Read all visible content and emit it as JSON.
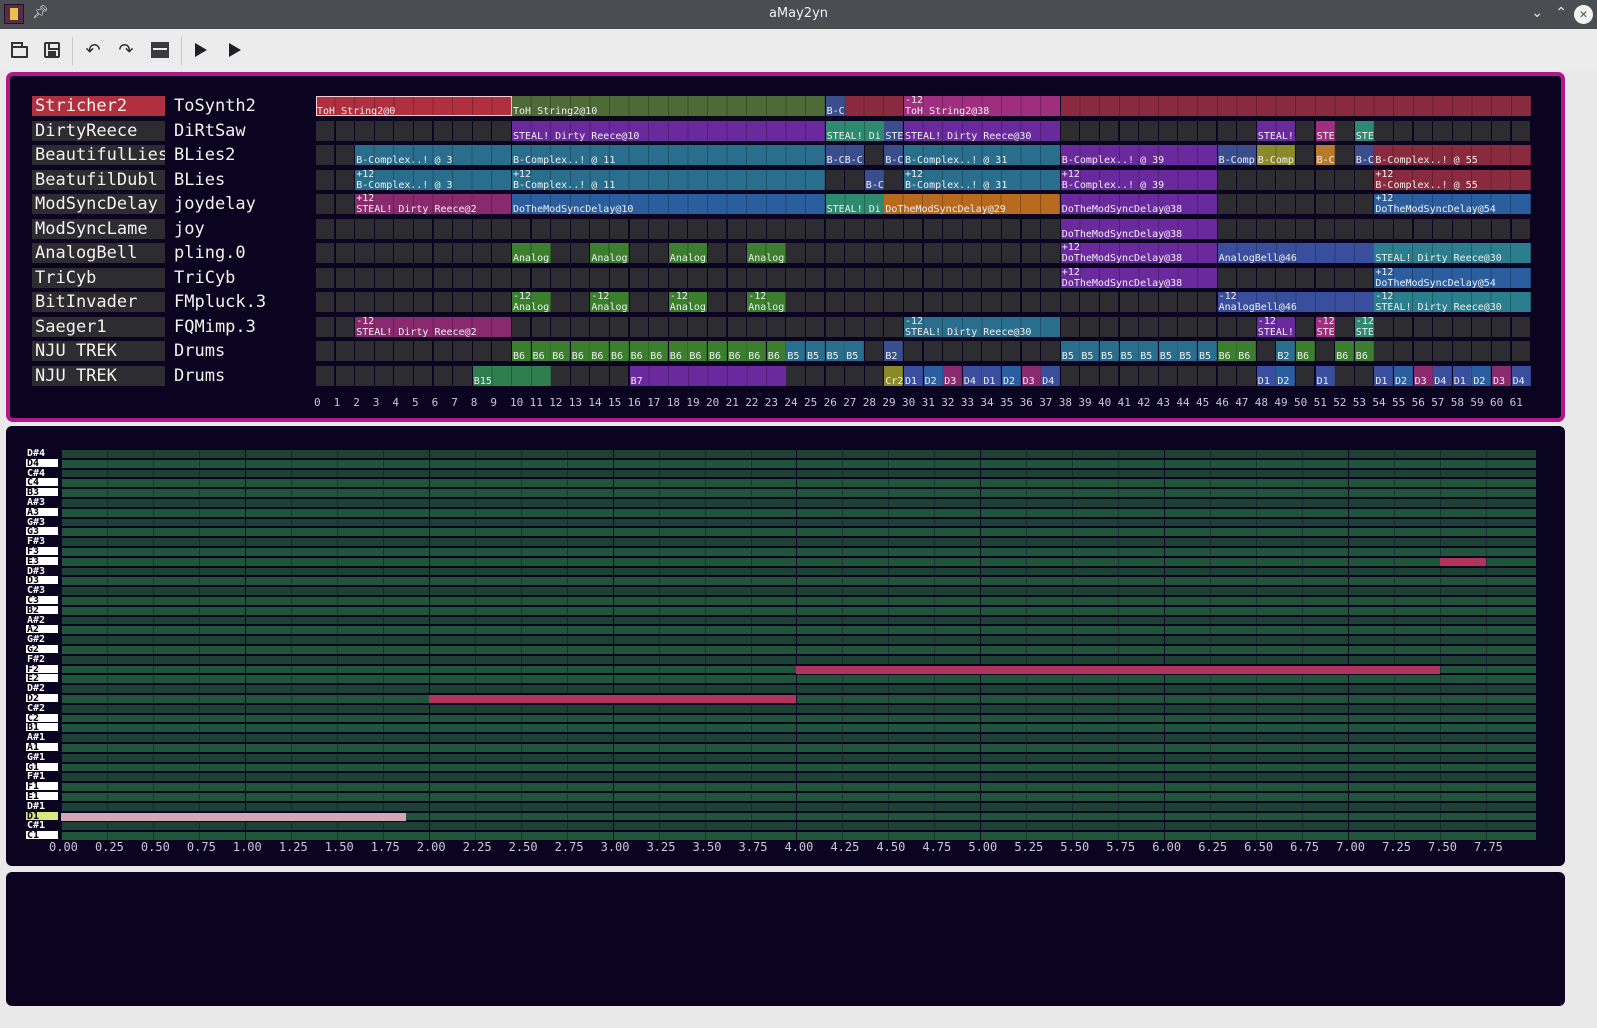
{
  "window": {
    "title": "aMay2yn"
  },
  "titlebar_icons": [
    "app-icon",
    "pin-icon",
    "minimize-icon",
    "maximize-icon",
    "close-icon"
  ],
  "toolbar": {
    "buttons": [
      "open-icon",
      "save-icon",
      "undo-icon",
      "redo-icon",
      "window-icon",
      "play-icon",
      "play-next-icon"
    ]
  },
  "colors": {
    "accent": "#b2178a",
    "panel_bg": "#0b0420",
    "selected_track": "#b03040",
    "note_piano": "#b0355c",
    "note_drum": "#d4a6b6"
  },
  "tracks": [
    {
      "name": "Stricher2",
      "instrument": "ToSynth2",
      "selected": true
    },
    {
      "name": "DirtyReece",
      "instrument": "DiRtSaw"
    },
    {
      "name": "BeautifulLies",
      "instrument": "BLies2"
    },
    {
      "name": "BeatufilDubl",
      "instrument": "BLies"
    },
    {
      "name": "ModSyncDelay",
      "instrument": "joydelay"
    },
    {
      "name": "ModSyncLame",
      "instrument": "joy"
    },
    {
      "name": "AnalogBell",
      "instrument": "pling.0"
    },
    {
      "name": "TriCyb",
      "instrument": "TriCyb"
    },
    {
      "name": "BitInvader",
      "instrument": "FMpluck.3"
    },
    {
      "name": "Saeger1",
      "instrument": "FQMimp.3"
    },
    {
      "name": "NJU TREK",
      "instrument": "Drums"
    },
    {
      "name": "NJU TREK",
      "instrument": "Drums"
    }
  ],
  "sequencer": {
    "beat_count": 62,
    "clips": [
      {
        "track": 0,
        "start": 0,
        "len": 10,
        "color": "#b03040",
        "label": "ToH_String2@0",
        "top": "",
        "outline": true
      },
      {
        "track": 0,
        "start": 10,
        "len": 16,
        "color": "#4e6a36",
        "label": "ToH_String2@10",
        "top": ""
      },
      {
        "track": 0,
        "start": 26,
        "len": 1,
        "color": "#3a4e8e",
        "label": "B-C",
        "top": ""
      },
      {
        "track": 0,
        "start": 27,
        "len": 3,
        "color": "#8a2a3e",
        "label": "",
        "top": ""
      },
      {
        "track": 0,
        "start": 30,
        "len": 8,
        "color": "#a02e7e",
        "label": "ToH_String2@38",
        "top": "-12"
      },
      {
        "track": 0,
        "start": 38,
        "len": 24,
        "color": "#8a2a3e",
        "label": "",
        "top": ""
      },
      {
        "track": 1,
        "start": 10,
        "len": 16,
        "color": "#6a2a9e",
        "label": "STEAL! Dirty Reece@10",
        "top": ""
      },
      {
        "track": 1,
        "start": 26,
        "len": 3,
        "color": "#2e8a6e",
        "label": "STEAL! Di",
        "top": ""
      },
      {
        "track": 1,
        "start": 29,
        "len": 1,
        "color": "#3a4e8e",
        "label": "STE",
        "top": ""
      },
      {
        "track": 1,
        "start": 30,
        "len": 8,
        "color": "#6a2a9e",
        "label": "STEAL! Dirty Reece@30",
        "top": ""
      },
      {
        "track": 1,
        "start": 48,
        "len": 2,
        "color": "#6a2a9e",
        "label": "STEAL!",
        "top": ""
      },
      {
        "track": 1,
        "start": 51,
        "len": 1,
        "color": "#a02e7e",
        "label": "STE",
        "top": ""
      },
      {
        "track": 1,
        "start": 53,
        "len": 1,
        "color": "#2e8a6e",
        "label": "STE",
        "top": ""
      },
      {
        "track": 2,
        "start": 2,
        "len": 8,
        "color": "#2a6e8e",
        "label": "B-Complex..! @ 3",
        "top": ""
      },
      {
        "track": 2,
        "start": 10,
        "len": 16,
        "color": "#2a6e8e",
        "label": "B-Complex..! @ 11",
        "top": ""
      },
      {
        "track": 2,
        "start": 26,
        "len": 2,
        "color": "#3a4e8e",
        "label": "B-CB-C",
        "top": ""
      },
      {
        "track": 2,
        "start": 29,
        "len": 1,
        "color": "#3a4e8e",
        "label": "B-C",
        "top": ""
      },
      {
        "track": 2,
        "start": 30,
        "len": 8,
        "color": "#2a6e8e",
        "label": "B-Complex..! @ 31",
        "top": ""
      },
      {
        "track": 2,
        "start": 38,
        "len": 8,
        "color": "#6a2a9e",
        "label": "B-Complex..! @ 39",
        "top": ""
      },
      {
        "track": 2,
        "start": 46,
        "len": 2,
        "color": "#3a4e8e",
        "label": "B-Comp",
        "top": ""
      },
      {
        "track": 2,
        "start": 48,
        "len": 2,
        "color": "#8a8a2a",
        "label": "B-Comp",
        "top": ""
      },
      {
        "track": 2,
        "start": 51,
        "len": 1,
        "color": "#b87a2a",
        "label": "B-C",
        "top": ""
      },
      {
        "track": 2,
        "start": 53,
        "len": 1,
        "color": "#3a4e8e",
        "label": "B-C",
        "top": ""
      },
      {
        "track": 2,
        "start": 54,
        "len": 8,
        "color": "#8a2a3e",
        "label": "B-Complex..! @ 55",
        "top": ""
      },
      {
        "track": 3,
        "start": 2,
        "len": 8,
        "color": "#2a6e8e",
        "label": "B-Complex..! @ 3",
        "top": "+12"
      },
      {
        "track": 3,
        "start": 10,
        "len": 16,
        "color": "#2a6e8e",
        "label": "B-Complex..! @ 11",
        "top": "+12"
      },
      {
        "track": 3,
        "start": 28,
        "len": 1,
        "color": "#3a4e8e",
        "label": "B-C",
        "top": ""
      },
      {
        "track": 3,
        "start": 30,
        "len": 8,
        "color": "#2a6e8e",
        "label": "B-Complex..! @ 31",
        "top": "+12"
      },
      {
        "track": 3,
        "start": 38,
        "len": 8,
        "color": "#6a2a9e",
        "label": "B-Complex..! @ 39",
        "top": "+12"
      },
      {
        "track": 3,
        "start": 54,
        "len": 8,
        "color": "#8a2a3e",
        "label": "B-Complex..! @ 55",
        "top": "+12"
      },
      {
        "track": 4,
        "start": 2,
        "len": 8,
        "color": "#8a2a6e",
        "label": "STEAL! Dirty Reece@2",
        "top": "+12"
      },
      {
        "track": 4,
        "start": 10,
        "len": 16,
        "color": "#2a5e9e",
        "label": "DoTheModSyncDelay@10",
        "top": ""
      },
      {
        "track": 4,
        "start": 26,
        "len": 3,
        "color": "#2e8a6e",
        "label": "STEAL! Di",
        "top": ""
      },
      {
        "track": 4,
        "start": 29,
        "len": 9,
        "color": "#b86a1e",
        "label": "DoTheModSyncDelay@29",
        "top": ""
      },
      {
        "track": 4,
        "start": 38,
        "len": 8,
        "color": "#6a2a9e",
        "label": "DoTheModSyncDelay@38",
        "top": ""
      },
      {
        "track": 4,
        "start": 54,
        "len": 8,
        "color": "#2a5e9e",
        "label": "DoTheModSyncDelay@54",
        "top": "+12"
      },
      {
        "track": 5,
        "start": 38,
        "len": 8,
        "color": "#6a2a9e",
        "label": "DoTheModSyncDelay@38",
        "top": ""
      },
      {
        "track": 6,
        "start": 10,
        "len": 2,
        "color": "#3a7e2e",
        "label": "Analog",
        "top": ""
      },
      {
        "track": 6,
        "start": 14,
        "len": 2,
        "color": "#3a7e2e",
        "label": "Analog",
        "top": ""
      },
      {
        "track": 6,
        "start": 18,
        "len": 2,
        "color": "#3a7e2e",
        "label": "Analog",
        "top": ""
      },
      {
        "track": 6,
        "start": 22,
        "len": 2,
        "color": "#3a7e2e",
        "label": "Analog",
        "top": ""
      },
      {
        "track": 6,
        "start": 38,
        "len": 8,
        "color": "#6a2a9e",
        "label": "DoTheModSyncDelay@38",
        "top": "+12"
      },
      {
        "track": 6,
        "start": 46,
        "len": 8,
        "color": "#3a4e9e",
        "label": "AnalogBell@46",
        "top": ""
      },
      {
        "track": 6,
        "start": 54,
        "len": 8,
        "color": "#2a7e8e",
        "label": "STEAL! Dirty Reece@30",
        "top": ""
      },
      {
        "track": 7,
        "start": 38,
        "len": 8,
        "color": "#6a2a9e",
        "label": "DoTheModSyncDelay@38",
        "top": "+12"
      },
      {
        "track": 7,
        "start": 54,
        "len": 8,
        "color": "#2a5e9e",
        "label": "DoTheModSyncDelay@54",
        "top": "+12"
      },
      {
        "track": 8,
        "start": 10,
        "len": 2,
        "color": "#3a7e2e",
        "label": "Analog",
        "top": "-12"
      },
      {
        "track": 8,
        "start": 14,
        "len": 2,
        "color": "#3a7e2e",
        "label": "Analog",
        "top": "-12"
      },
      {
        "track": 8,
        "start": 18,
        "len": 2,
        "color": "#3a7e2e",
        "label": "Analog",
        "top": "-12"
      },
      {
        "track": 8,
        "start": 22,
        "len": 2,
        "color": "#3a7e2e",
        "label": "Analog",
        "top": "-12"
      },
      {
        "track": 8,
        "start": 46,
        "len": 8,
        "color": "#3a4e9e",
        "label": "AnalogBell@46",
        "top": "-12"
      },
      {
        "track": 8,
        "start": 54,
        "len": 8,
        "color": "#2a7e8e",
        "label": "STEAL! Dirty Reece@30",
        "top": "-12"
      },
      {
        "track": 9,
        "start": 2,
        "len": 8,
        "color": "#8a2a6e",
        "label": "STEAL! Dirty Reece@2",
        "top": "-12"
      },
      {
        "track": 9,
        "start": 30,
        "len": 8,
        "color": "#2a6e8e",
        "label": "STEAL! Dirty Reece@30",
        "top": "-12"
      },
      {
        "track": 9,
        "start": 48,
        "len": 2,
        "color": "#6a2a9e",
        "label": "STEAL!",
        "top": "-12"
      },
      {
        "track": 9,
        "start": 51,
        "len": 1,
        "color": "#a02e7e",
        "label": "STE",
        "top": "-12"
      },
      {
        "track": 9,
        "start": 53,
        "len": 1,
        "color": "#2e8a6e",
        "label": "STE",
        "top": "-12"
      },
      {
        "track": 10,
        "start": 10,
        "len": 1,
        "color": "#3a7e2e",
        "label": "B6",
        "top": ""
      },
      {
        "track": 10,
        "start": 11,
        "len": 1,
        "color": "#3a7e2e",
        "label": "B6",
        "top": ""
      },
      {
        "track": 10,
        "start": 12,
        "len": 1,
        "color": "#3a7e2e",
        "label": "B6",
        "top": ""
      },
      {
        "track": 10,
        "start": 13,
        "len": 1,
        "color": "#3a7e2e",
        "label": "B6",
        "top": ""
      },
      {
        "track": 10,
        "start": 14,
        "len": 1,
        "color": "#3a7e2e",
        "label": "B6",
        "top": ""
      },
      {
        "track": 10,
        "start": 15,
        "len": 1,
        "color": "#3a7e2e",
        "label": "B6",
        "top": ""
      },
      {
        "track": 10,
        "start": 16,
        "len": 1,
        "color": "#3a7e2e",
        "label": "B6",
        "top": ""
      },
      {
        "track": 10,
        "start": 17,
        "len": 1,
        "color": "#3a7e2e",
        "label": "B6",
        "top": ""
      },
      {
        "track": 10,
        "start": 18,
        "len": 1,
        "color": "#3a7e2e",
        "label": "B6",
        "top": ""
      },
      {
        "track": 10,
        "start": 19,
        "len": 1,
        "color": "#3a7e2e",
        "label": "B6",
        "top": ""
      },
      {
        "track": 10,
        "start": 20,
        "len": 1,
        "color": "#3a7e2e",
        "label": "B6",
        "top": ""
      },
      {
        "track": 10,
        "start": 21,
        "len": 1,
        "color": "#3a7e2e",
        "label": "B6",
        "top": ""
      },
      {
        "track": 10,
        "start": 22,
        "len": 1,
        "color": "#3a7e2e",
        "label": "B6",
        "top": ""
      },
      {
        "track": 10,
        "start": 23,
        "len": 1,
        "color": "#3a7e2e",
        "label": "B6",
        "top": ""
      },
      {
        "track": 10,
        "start": 24,
        "len": 1,
        "color": "#2a6e8e",
        "label": "B5",
        "top": ""
      },
      {
        "track": 10,
        "start": 25,
        "len": 1,
        "color": "#2a6e8e",
        "label": "B5",
        "top": ""
      },
      {
        "track": 10,
        "start": 26,
        "len": 1,
        "color": "#2a6e8e",
        "label": "B5",
        "top": ""
      },
      {
        "track": 10,
        "start": 27,
        "len": 1,
        "color": "#2a6e8e",
        "label": "B5",
        "top": ""
      },
      {
        "track": 10,
        "start": 29,
        "len": 1,
        "color": "#3a4e8e",
        "label": "B2",
        "top": ""
      },
      {
        "track": 10,
        "start": 38,
        "len": 1,
        "color": "#2a6e8e",
        "label": "B5",
        "top": ""
      },
      {
        "track": 10,
        "start": 39,
        "len": 1,
        "color": "#2a6e8e",
        "label": "B5",
        "top": ""
      },
      {
        "track": 10,
        "start": 40,
        "len": 1,
        "color": "#2a6e8e",
        "label": "B5",
        "top": ""
      },
      {
        "track": 10,
        "start": 41,
        "len": 1,
        "color": "#2a6e8e",
        "label": "B5",
        "top": ""
      },
      {
        "track": 10,
        "start": 42,
        "len": 1,
        "color": "#2a6e8e",
        "label": "B5",
        "top": ""
      },
      {
        "track": 10,
        "start": 43,
        "len": 1,
        "color": "#2a6e8e",
        "label": "B5",
        "top": ""
      },
      {
        "track": 10,
        "start": 44,
        "len": 1,
        "color": "#2a6e8e",
        "label": "B5",
        "top": ""
      },
      {
        "track": 10,
        "start": 45,
        "len": 1,
        "color": "#2a6e8e",
        "label": "B5",
        "top": ""
      },
      {
        "track": 10,
        "start": 46,
        "len": 1,
        "color": "#3a7e2e",
        "label": "B6",
        "top": ""
      },
      {
        "track": 10,
        "start": 47,
        "len": 1,
        "color": "#3a7e2e",
        "label": "B6",
        "top": ""
      },
      {
        "track": 10,
        "start": 49,
        "len": 1,
        "color": "#2a6e8e",
        "label": "B2",
        "top": ""
      },
      {
        "track": 10,
        "start": 50,
        "len": 1,
        "color": "#3a7e2e",
        "label": "B6",
        "top": ""
      },
      {
        "track": 10,
        "start": 52,
        "len": 1,
        "color": "#3a7e2e",
        "label": "B6",
        "top": ""
      },
      {
        "track": 10,
        "start": 53,
        "len": 1,
        "color": "#3a7e2e",
        "label": "B6",
        "top": ""
      },
      {
        "track": 11,
        "start": 8,
        "len": 4,
        "color": "#2e7e4e",
        "label": "B15",
        "top": ""
      },
      {
        "track": 11,
        "start": 16,
        "len": 8,
        "color": "#6a2a9e",
        "label": "B7",
        "top": ""
      },
      {
        "track": 11,
        "start": 29,
        "len": 1,
        "color": "#8a8a2a",
        "label": "Cr2",
        "top": ""
      },
      {
        "track": 11,
        "start": 30,
        "len": 1,
        "color": "#3a4e9e",
        "label": "D1",
        "top": ""
      },
      {
        "track": 11,
        "start": 31,
        "len": 1,
        "color": "#2a5e9e",
        "label": "D2",
        "top": ""
      },
      {
        "track": 11,
        "start": 32,
        "len": 1,
        "color": "#8a2a6e",
        "label": "D3",
        "top": ""
      },
      {
        "track": 11,
        "start": 33,
        "len": 1,
        "color": "#3a4e9e",
        "label": "D4",
        "top": ""
      },
      {
        "track": 11,
        "start": 34,
        "len": 1,
        "color": "#3a4e9e",
        "label": "D1",
        "top": ""
      },
      {
        "track": 11,
        "start": 35,
        "len": 1,
        "color": "#2a5e9e",
        "label": "D2",
        "top": ""
      },
      {
        "track": 11,
        "start": 36,
        "len": 1,
        "color": "#8a2a6e",
        "label": "D3",
        "top": ""
      },
      {
        "track": 11,
        "start": 37,
        "len": 1,
        "color": "#3a4e9e",
        "label": "D4",
        "top": ""
      },
      {
        "track": 11,
        "start": 48,
        "len": 1,
        "color": "#3a4e9e",
        "label": "D1",
        "top": ""
      },
      {
        "track": 11,
        "start": 49,
        "len": 1,
        "color": "#2a5e9e",
        "label": "D2",
        "top": ""
      },
      {
        "track": 11,
        "start": 51,
        "len": 1,
        "color": "#3a4e9e",
        "label": "D1",
        "top": ""
      },
      {
        "track": 11,
        "start": 54,
        "len": 1,
        "color": "#3a4e9e",
        "label": "D1",
        "top": ""
      },
      {
        "track": 11,
        "start": 55,
        "len": 1,
        "color": "#2a5e9e",
        "label": "D2",
        "top": ""
      },
      {
        "track": 11,
        "start": 56,
        "len": 1,
        "color": "#8a2a6e",
        "label": "D3",
        "top": ""
      },
      {
        "track": 11,
        "start": 57,
        "len": 1,
        "color": "#3a4e9e",
        "label": "D4",
        "top": ""
      },
      {
        "track": 11,
        "start": 58,
        "len": 1,
        "color": "#3a4e9e",
        "label": "D1",
        "top": ""
      },
      {
        "track": 11,
        "start": 59,
        "len": 1,
        "color": "#2a5e9e",
        "label": "D2",
        "top": ""
      },
      {
        "track": 11,
        "start": 60,
        "len": 1,
        "color": "#8a2a6e",
        "label": "D3",
        "top": ""
      },
      {
        "track": 11,
        "start": 61,
        "len": 1,
        "color": "#3a4e9e",
        "label": "D4",
        "top": ""
      }
    ]
  },
  "piano_roll": {
    "note_names": [
      "D#4",
      "D4",
      "C#4",
      "C4",
      "B3",
      "A#3",
      "A3",
      "G#3",
      "G3",
      "F#3",
      "F3",
      "E3",
      "D#3",
      "D3",
      "C#3",
      "C3",
      "B2",
      "A#2",
      "A2",
      "G#2",
      "G2",
      "F#2",
      "F2",
      "E2",
      "D#2",
      "D2",
      "C#2",
      "C2",
      "B1",
      "A#1",
      "A1",
      "G#1",
      "G1",
      "F#1",
      "F1",
      "E1",
      "D#1",
      "D1",
      "C#1",
      "C1"
    ],
    "highlighted_note": "D1",
    "ticks": [
      "0.00",
      "0.25",
      "0.50",
      "0.75",
      "1.00",
      "1.25",
      "1.50",
      "1.75",
      "2.00",
      "2.25",
      "2.50",
      "2.75",
      "3.00",
      "3.25",
      "3.50",
      "3.75",
      "4.00",
      "4.25",
      "4.50",
      "4.75",
      "5.00",
      "5.25",
      "5.50",
      "5.75",
      "6.00",
      "6.25",
      "6.50",
      "6.75",
      "7.00",
      "7.25",
      "7.50",
      "7.75"
    ],
    "notes": [
      {
        "note": "D1",
        "start": 0.0,
        "end": 1.875,
        "color": "#d4a6b6"
      },
      {
        "note": "D2",
        "start": 2.0,
        "end": 4.0,
        "color": "#b0355c"
      },
      {
        "note": "F2",
        "start": 4.0,
        "end": 7.5,
        "color": "#b0355c"
      },
      {
        "note": "E3",
        "start": 7.5,
        "end": 7.75,
        "color": "#b0355c"
      }
    ]
  }
}
